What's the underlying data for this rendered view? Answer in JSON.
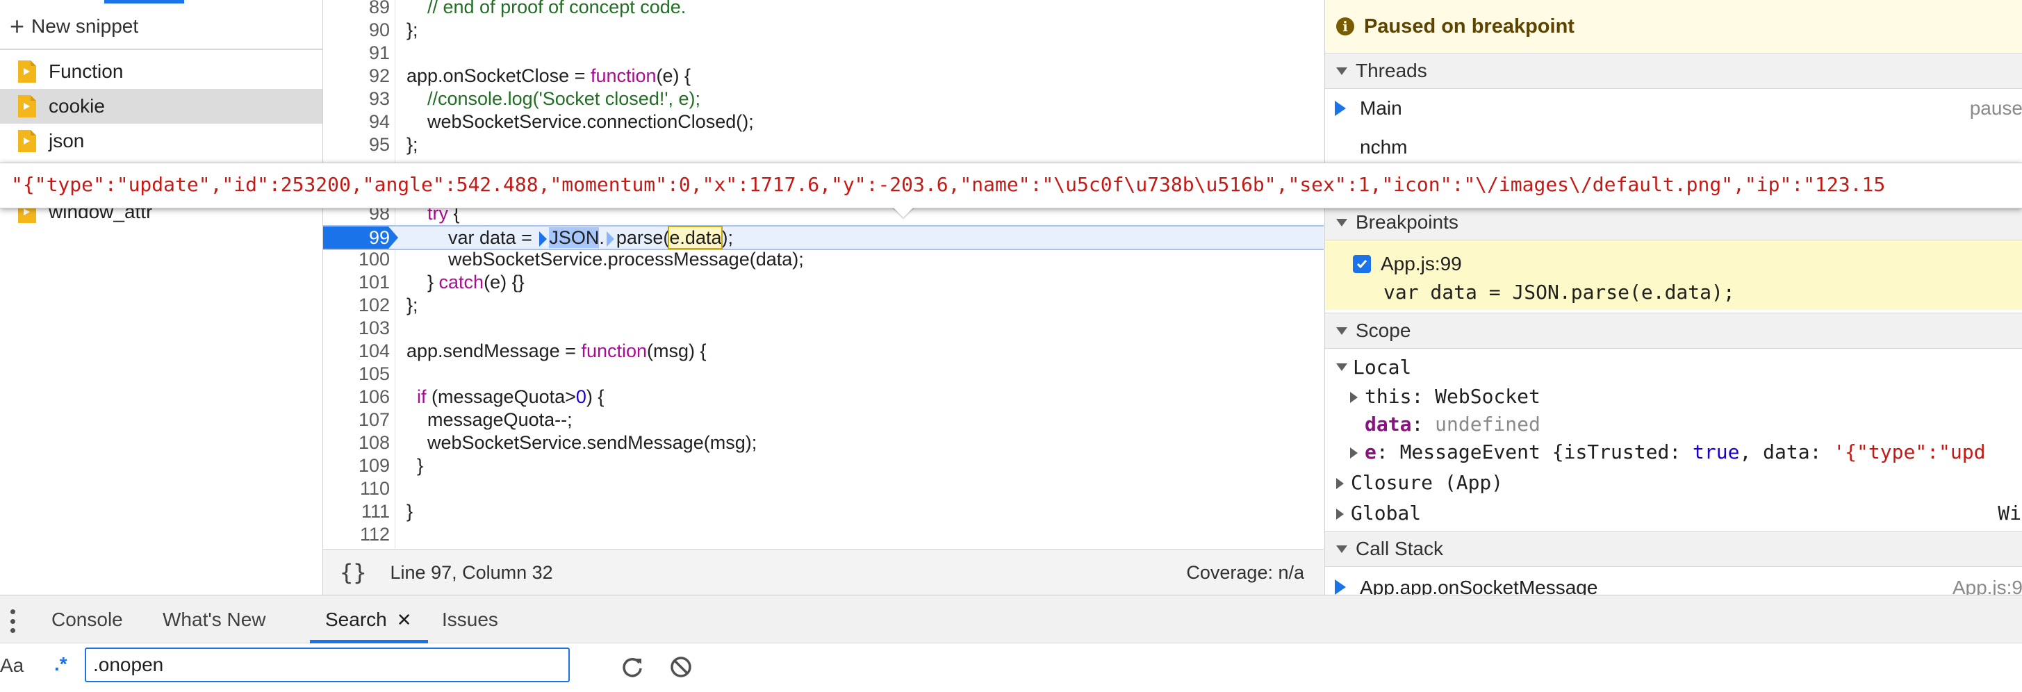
{
  "snippets": {
    "new_label": "New snippet",
    "items": [
      {
        "label": "Function"
      },
      {
        "label": "cookie"
      },
      {
        "label": "json"
      },
      {
        "label": "window_attr"
      }
    ]
  },
  "editor": {
    "lines": [
      {
        "n": "89",
        "code": "    // end of proof of concept code."
      },
      {
        "n": "90",
        "code": "};"
      },
      {
        "n": "91",
        "code": ""
      },
      {
        "n": "92",
        "pre": "app.onSocketClose = ",
        "kw": "function",
        "post": "(e) {"
      },
      {
        "n": "93",
        "comment": "    //console.log('Socket closed!', e);"
      },
      {
        "n": "94",
        "code": "    webSocketService.connectionClosed();"
      },
      {
        "n": "95",
        "code": "};"
      },
      {
        "n": "98",
        "kwpre": "    ",
        "kw": "try",
        "post": " {"
      },
      {
        "n": "99",
        "a": "        var data = ",
        "b": "JSON",
        "c": ".",
        "d": "parse(",
        "e": "e.data",
        "f": ");"
      },
      {
        "n": "100",
        "code": "        webSocketService.processMessage(data);"
      },
      {
        "n": "101",
        "pre": "    } ",
        "kw": "catch",
        "post": "(e) {}"
      },
      {
        "n": "102",
        "code": "};"
      },
      {
        "n": "103",
        "code": ""
      },
      {
        "n": "104",
        "pre": "app.sendMessage = ",
        "kw": "function",
        "post": "(msg) {"
      },
      {
        "n": "105",
        "code": ""
      },
      {
        "n": "106",
        "kwpre": "  ",
        "kw": "if",
        "mid": " (messageQuota>",
        "num": "0",
        "post": ") {"
      },
      {
        "n": "107",
        "code": "    messageQuota--;"
      },
      {
        "n": "108",
        "code": "    webSocketService.sendMessage(msg);"
      },
      {
        "n": "109",
        "code": "  }"
      },
      {
        "n": "110",
        "code": ""
      },
      {
        "n": "111",
        "code": "}"
      },
      {
        "n": "112",
        "code": ""
      }
    ],
    "status": {
      "braces": "{}",
      "cursor": "Line 97, Column 32",
      "coverage": "Coverage: n/a"
    }
  },
  "tooltip": {
    "text": "\"{\"type\":\"update\",\"id\":253200,\"angle\":542.488,\"momentum\":0,\"x\":1717.6,\"y\":-203.6,\"name\":\"\\u5c0f\\u738b\\u516b\",\"sex\":1,\"icon\":\"\\/images\\/default.png\",\"ip\":\"123.15"
  },
  "debugger": {
    "paused": "Paused on breakpoint",
    "threads": {
      "title": "Threads",
      "items": [
        {
          "name": "Main",
          "state": "pause"
        },
        {
          "name": "nchm",
          "state": ""
        }
      ]
    },
    "breakpoints": {
      "title": "Breakpoints",
      "file": "App.js:99",
      "code": "var data = JSON.parse(e.data);"
    },
    "scope": {
      "title": "Scope",
      "local": "Local",
      "this_key": "this",
      "this_val": "WebSocket",
      "data_key": "data",
      "data_val": "undefined",
      "e_key": "e",
      "e_type": "MessageEvent {isTrusted: ",
      "e_true": "true",
      "e_mid": ", data: ",
      "e_str": "'{\"type\":\"upd",
      "closure": "Closure (App)",
      "global": "Global",
      "global_val": "Wi"
    },
    "callstack": {
      "title": "Call Stack",
      "frame": "App.app.onSocketMessage",
      "location": "App.js:9"
    }
  },
  "drawer": {
    "tabs": [
      {
        "label": "Console"
      },
      {
        "label": "What's New"
      },
      {
        "label": "Search"
      },
      {
        "label": "Issues"
      }
    ],
    "close_glyph": "✕",
    "search": {
      "aa": "Aa",
      "regex": ".*",
      "value": ".onopen"
    }
  },
  "colors": {
    "accent": "#1a73e8",
    "keyword": "#aa0d91",
    "string": "#c41a16",
    "paused_bg": "#fffbe5"
  }
}
